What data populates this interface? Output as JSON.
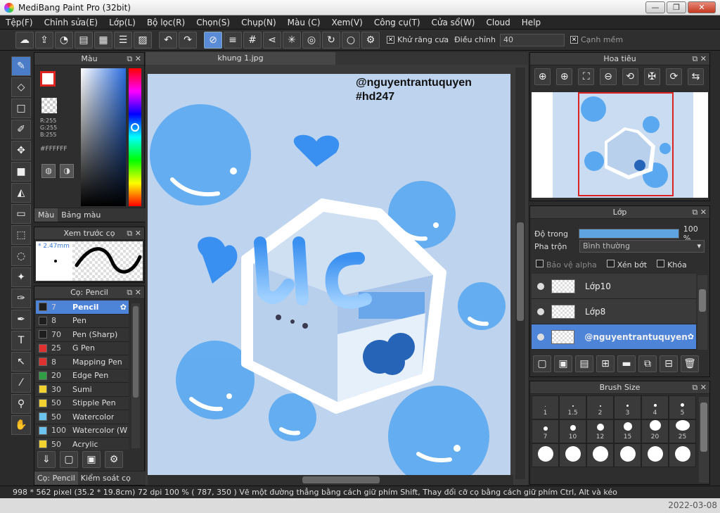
{
  "app": {
    "title": "MediBang Paint Pro (32bit)",
    "minimize": "—",
    "restore": "❐",
    "close": "✕"
  },
  "menu": [
    "Tệp(F)",
    "Chỉnh sửa(E)",
    "Lớp(L)",
    "Bộ lọc(R)",
    "Chọn(S)",
    "Chụp(N)",
    "Màu (C)",
    "Xem(V)",
    "Công cụ(T)",
    "Cửa sổ(W)",
    "Cloud",
    "Help"
  ],
  "toolbar": {
    "antialias_label": "Khử răng cưa",
    "adjust_label": "Điều chỉnh",
    "adjust_value": "40",
    "soft_edge_label": "Cạnh mềm"
  },
  "color_panel": {
    "title": "Màu",
    "r": "R:255",
    "g": "G:255",
    "b": "B:255",
    "hex": "#FFFFFF",
    "tab_color": "Màu",
    "tab_palette": "Bảng màu"
  },
  "brush_preview": {
    "title": "Xem trước cọ",
    "size": "* 2.47mm"
  },
  "brush_panel": {
    "title": "Cọ: Pencil",
    "brushes": [
      {
        "size": "7",
        "name": "Pencil",
        "color": "#1e1e1e"
      },
      {
        "size": "8",
        "name": "Pen",
        "color": "#1e1e1e"
      },
      {
        "size": "70",
        "name": "Pen (Sharp)",
        "color": "#1e1e1e"
      },
      {
        "size": "25",
        "name": "G Pen",
        "color": "#e03131"
      },
      {
        "size": "8",
        "name": "Mapping Pen",
        "color": "#e03131"
      },
      {
        "size": "20",
        "name": "Edge Pen",
        "color": "#2f9e44"
      },
      {
        "size": "30",
        "name": "Sumi",
        "color": "#f2d230"
      },
      {
        "size": "50",
        "name": "Stipple Pen",
        "color": "#f2d230"
      },
      {
        "size": "50",
        "name": "Watercolor",
        "color": "#6cc3f0"
      },
      {
        "size": "100",
        "name": "Watercolor (W",
        "color": "#6cc3f0"
      },
      {
        "size": "50",
        "name": "Acrylic",
        "color": "#f2d230"
      }
    ],
    "tab_brush": "Cọ: Pencil",
    "tab_control": "Kiểm soát cọ"
  },
  "canvas": {
    "tab": "khung 1.jpg",
    "watermark_line1": "@nguyentrantuquyen",
    "watermark_line2": "#hd247"
  },
  "navigator": {
    "title": "Hoa tiêu"
  },
  "layers_panel": {
    "title": "Lớp",
    "opacity_label": "Độ trong",
    "opacity_value": "100 %",
    "opacity_fraction": 1.0,
    "blend_label": "Pha trộn",
    "blend_value": "Bình thường",
    "protect_alpha": "Bảo vệ alpha",
    "clipping": "Xén bớt",
    "lock": "Khóa",
    "layers": [
      {
        "name": "Lớp10",
        "selected": false
      },
      {
        "name": "Lớp8",
        "selected": false
      },
      {
        "name": "@nguyentrantuquyen",
        "selected": true
      }
    ]
  },
  "brush_size_panel": {
    "title": "Brush Size",
    "sizes": [
      "1",
      "1.5",
      "2",
      "3",
      "4",
      "5",
      "7",
      "10",
      "12",
      "15",
      "20",
      "25",
      "",
      "",
      "",
      "",
      "",
      ""
    ]
  },
  "status": {
    "text": "998 * 562 pixel   (35.2 * 19.8cm)   72 dpi   100 %   ( 787, 350 )   Vẽ một đường thẳng bằng cách giữ phím Shift, Thay đổi cỡ cọ bằng cách giữ phím Ctrl, Alt và kéo"
  },
  "taskbar": {
    "date": "2022-03-08"
  }
}
